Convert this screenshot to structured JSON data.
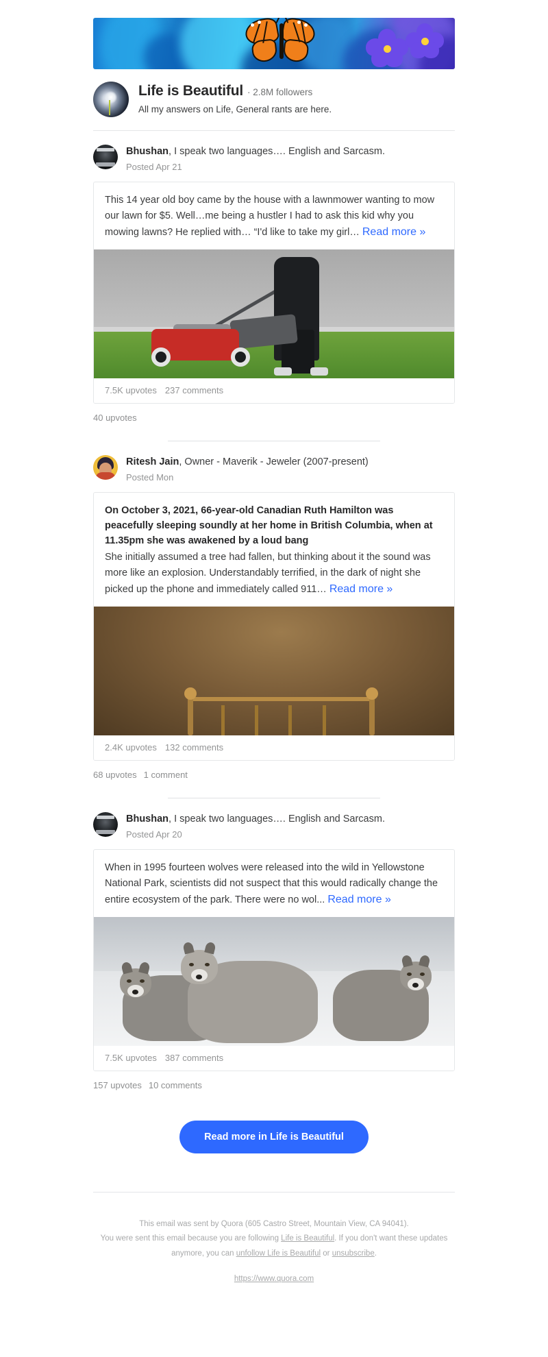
{
  "brand": {
    "accent": "#2e69ff",
    "text": "#282829",
    "muted": "#939495"
  },
  "banner": {
    "alt": "butterfly-and-flowers-banner"
  },
  "space": {
    "name": "Life is Beautiful",
    "followers": "· 2.8M followers",
    "description": "All my answers on Life, General rants are here."
  },
  "posts": [
    {
      "author_name": "Bhushan",
      "author_bio": ", I speak two languages…. English and Sarcasm.",
      "posted": "Posted Apr 21",
      "title": "",
      "text": "This 14 year old boy came by the house with a lawnmower wanting to mow our lawn for $5. Well…me being a hustler I had to ask this kid why you mowing lawns? He replied with… “I'd like to take my girl… ",
      "read_more": "Read more »",
      "image_alt": "boy-mowing-lawn-photo",
      "answer_upvotes": "7.5K upvotes",
      "answer_comments": "237 comments",
      "post_upvotes": "40 upvotes",
      "post_comments": ""
    },
    {
      "author_name": "Ritesh Jain",
      "author_bio": ", Owner - Maverik - Jeweler (2007-present)",
      "posted": "Posted Mon",
      "title": "On October 3, 2021, 66-year-old Canadian Ruth Hamilton was peacefully sleeping soundly at her home in British Columbia, when at 11.35pm she was awakened by a loud bang",
      "text": "She initially assumed a tree had fallen, but thinking about it the sound was more like an explosion. Understandably terrified, in the dark of night she picked up the phone and immediately called 911… ",
      "read_more": "Read more »",
      "image_alt": "bedroom-headboard-photo",
      "answer_upvotes": "2.4K upvotes",
      "answer_comments": "132 comments",
      "post_upvotes": "68 upvotes",
      "post_comments": "1 comment"
    },
    {
      "author_name": "Bhushan",
      "author_bio": ", I speak two languages…. English and Sarcasm.",
      "posted": "Posted Apr 20",
      "title": "",
      "text": "When in 1995 fourteen wolves were released into the wild in Yellowstone National Park, scientists did not suspect that this would radically change the entire ecosystem of the park. There were no wol... ",
      "read_more": "Read more »",
      "image_alt": "three-wolves-in-snow-photo",
      "answer_upvotes": "7.5K upvotes",
      "answer_comments": "387 comments",
      "post_upvotes": "157 upvotes",
      "post_comments": "10 comments"
    }
  ],
  "cta": {
    "label": "Read more in Life is Beautiful"
  },
  "footer": {
    "line1": "This email was sent by Quora (605 Castro Street, Mountain View, CA 94041).",
    "line2_a": "You were sent this email because you are following ",
    "line2_link": "Life is Beautiful",
    "line2_b": ". If you don't want these updates",
    "line3_a": "anymore, you can ",
    "line3_link1": "unfollow Life is Beautiful",
    "line3_mid": " or ",
    "line3_link2": "unsubscribe",
    "line3_b": ".",
    "site": "https://www.quora.com"
  }
}
